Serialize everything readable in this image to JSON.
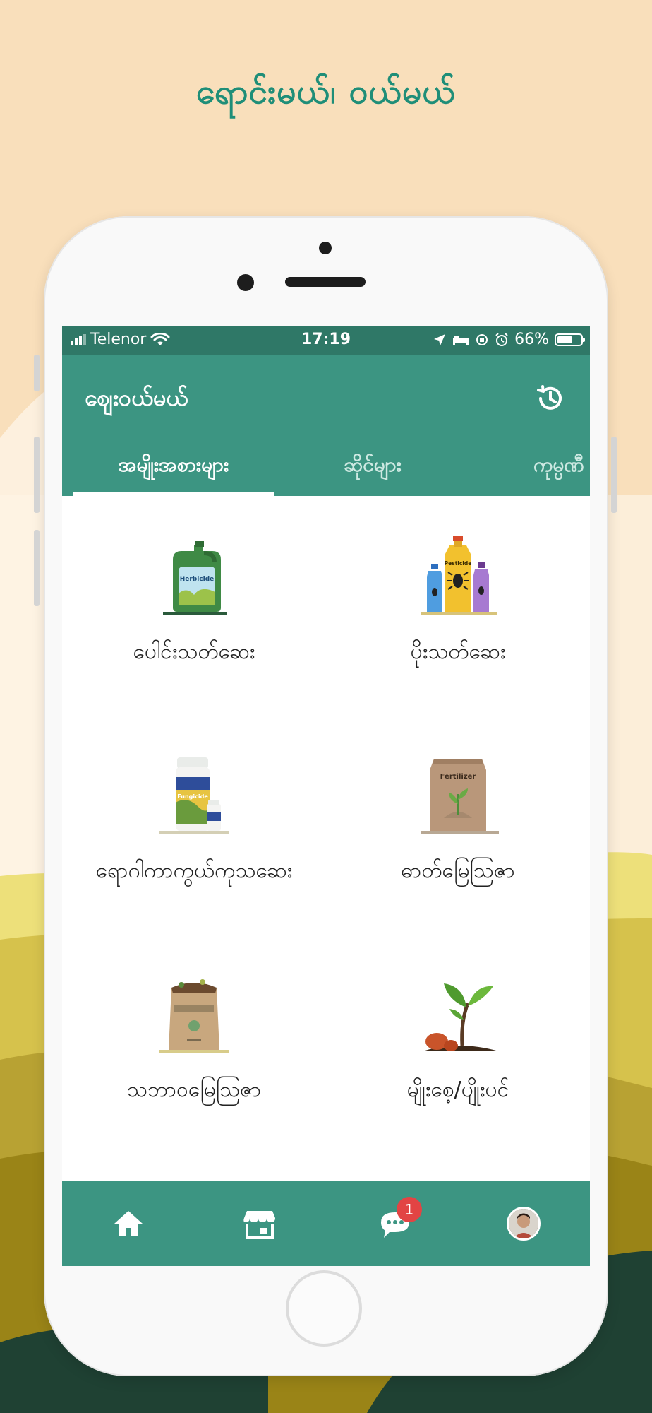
{
  "promo": {
    "title": "ရောင်းမယ်၊ ဝယ်မယ်"
  },
  "status_bar": {
    "carrier": "Telenor",
    "time": "17:19",
    "battery_text": "66%",
    "battery_level": 0.66
  },
  "app_bar": {
    "title": "ဈေးဝယ်မယ်",
    "history_icon": "history-icon"
  },
  "tabs": [
    {
      "label": "အမျိုးအစားများ",
      "active": true
    },
    {
      "label": "ဆိုင်များ",
      "active": false
    },
    {
      "label": "ကုမ္ပဏီ",
      "active": false
    }
  ],
  "categories": [
    {
      "label": "ပေါင်းသတ်ဆေး",
      "icon": "herbicide-icon",
      "icon_text": "Herbicide"
    },
    {
      "label": "ပိုးသတ်ဆေး",
      "icon": "pesticide-icon",
      "icon_text": "Pesticide"
    },
    {
      "label": "ရောဂါကာကွယ်ကုသဆေး",
      "icon": "fungicide-icon",
      "icon_text": "Fungicide"
    },
    {
      "label": "ဓာတ်မြေသြဇာ",
      "icon": "fertilizer-icon",
      "icon_text": "Fertilizer"
    },
    {
      "label": "သဘာဝမြေသြဇာ",
      "icon": "compost-icon"
    },
    {
      "label": "မျိုးစေ့/ပျိုးပင်",
      "icon": "seedling-icon"
    }
  ],
  "bottom_nav": {
    "items": [
      "home-icon",
      "store-icon",
      "chat-icon",
      "profile-avatar"
    ],
    "chat_badge": "1"
  },
  "colors": {
    "primary": "#3c9582",
    "status_bar": "#2f7867",
    "promo_text": "#1f8e78",
    "background": "#f9dfbb",
    "badge": "#e24444"
  }
}
